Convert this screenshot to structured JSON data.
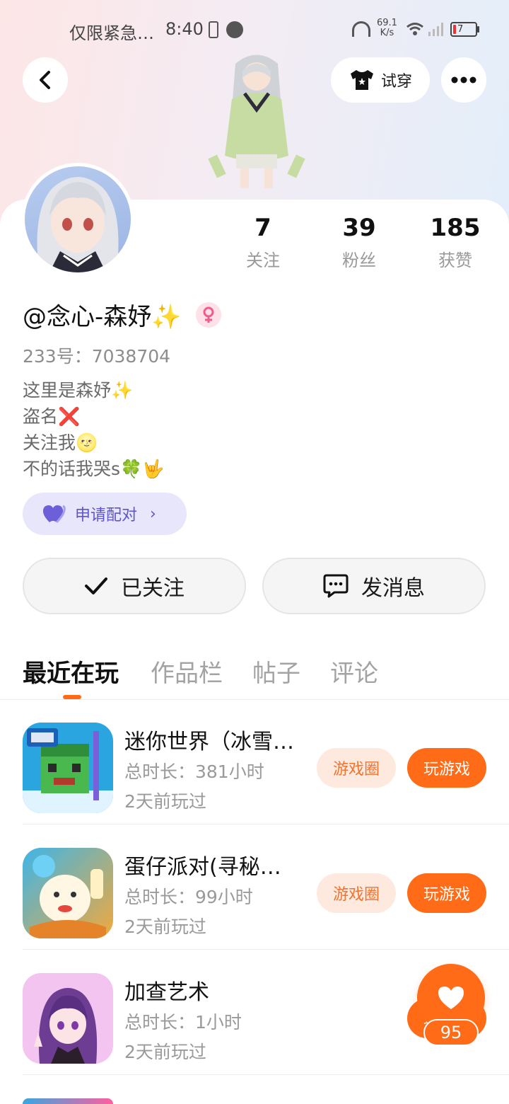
{
  "status_bar": {
    "notice": "仅限紧急…",
    "time": "8:40",
    "net_speed_value": "69.1",
    "net_speed_unit": "K/s",
    "battery_level": "7"
  },
  "header": {
    "try_on_label": "试穿"
  },
  "profile": {
    "username": "@念心-森妤✨",
    "id_label": "233号：7038704",
    "bio": [
      "这里是森妤✨",
      "盗名❌",
      "关注我🌝",
      "不的话我哭s🍀🤟"
    ],
    "pair_label": "申请配对",
    "stats": [
      {
        "num": "7",
        "label": "关注"
      },
      {
        "num": "39",
        "label": "粉丝"
      },
      {
        "num": "185",
        "label": "获赞"
      }
    ]
  },
  "actions": {
    "follow_label": "已关注",
    "message_label": "发消息"
  },
  "tabs": [
    "最近在玩",
    "作品栏",
    "帖子",
    "评论"
  ],
  "games": [
    {
      "name": "迷你世界（冰雪…",
      "time": "总时长：381小时",
      "last": "2天前玩过",
      "circle": "游戏圈",
      "play": "玩游戏"
    },
    {
      "name": "蛋仔派对(寻秘…",
      "time": "总时长：99小时",
      "last": "2天前玩过",
      "circle": "游戏圈",
      "play": "玩游戏"
    },
    {
      "name": "加查艺术",
      "time": "总时长：1小时",
      "last": "2天前玩过",
      "play": "玩游戏"
    }
  ],
  "float_like": {
    "count": "95"
  },
  "colors": {
    "accent": "#ff6b16",
    "pair": "#5e56c8",
    "circle_bg": "#fde9dd"
  }
}
